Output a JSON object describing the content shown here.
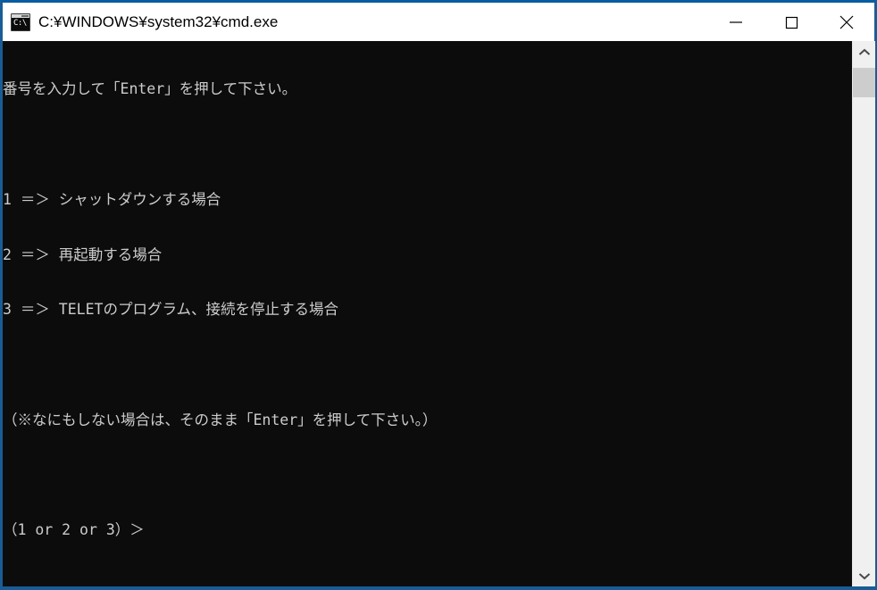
{
  "window": {
    "title": "C:\\WINDOWS\\system32\\cmd.exe",
    "title_display": "C:¥WINDOWS¥system32¥cmd.exe",
    "icon_name": "cmd-icon",
    "icon_text": "C:\\",
    "frame_color": "#1a5c96",
    "titlebar_bg": "#ffffff",
    "titlebar_fg": "#000000"
  },
  "controls": {
    "minimize_label": "—",
    "maximize_label": "□",
    "close_label": "✕"
  },
  "terminal": {
    "bg": "#0c0c0c",
    "fg": "#cccccc",
    "lines": [
      "番号を入力して「Enter」を押して下さい。",
      "",
      "1 ＝＞ シャットダウンする場合",
      "2 ＝＞ 再起動する場合",
      "3 ＝＞ TELETのプログラム、接続を停止する場合",
      "",
      "（※なにもしない場合は、そのまま「Enter」を押して下さい。）",
      "",
      "（1 or 2 or 3）＞"
    ]
  },
  "scrollbar": {
    "up_arrow": "⌃",
    "down_arrow": "⌄",
    "thumb_color": "#cdcdcd",
    "track_color": "#f0f0f0"
  }
}
